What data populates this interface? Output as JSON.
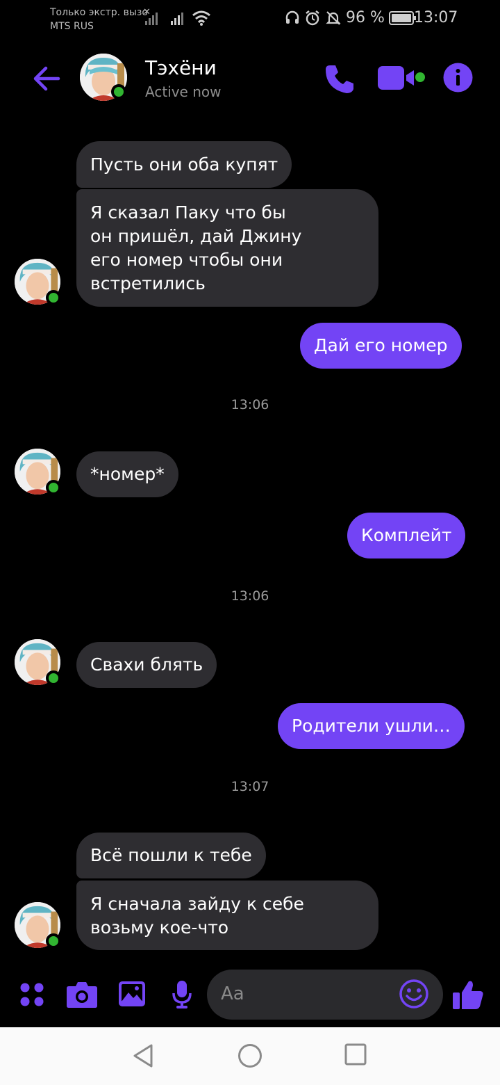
{
  "status_bar": {
    "carrier_line1": "Только экстр. вызо",
    "carrier_line2": "MTS RUS",
    "battery": "96 %",
    "time": "13:07"
  },
  "header": {
    "contact_name": "Тэхёни",
    "status": "Active now",
    "icons": [
      "back-arrow-icon",
      "phone-icon",
      "video-camera-icon",
      "info-icon"
    ]
  },
  "messages": [
    {
      "side": "in",
      "text": "Пусть они оба купят"
    },
    {
      "side": "in",
      "lines": [
        "Я сказал Паку что бы",
        "он пришёл, дай Джину",
        "его номер чтобы они",
        "встретились"
      ]
    },
    {
      "side": "out",
      "text": "Дай его номер"
    },
    {
      "timestamp": "13:06"
    },
    {
      "side": "in",
      "text": "*номер*"
    },
    {
      "side": "out",
      "text": "Комплейт"
    },
    {
      "timestamp": "13:06"
    },
    {
      "side": "in",
      "text": "Свахи блять"
    },
    {
      "side": "out",
      "text": "Родители ушли…"
    },
    {
      "timestamp": "13:07"
    },
    {
      "side": "in",
      "text": "Всё пошли к тебе"
    },
    {
      "side": "in",
      "lines": [
        "Я сначала зайду к себе",
        "возьму кое-что"
      ]
    }
  ],
  "composer": {
    "placeholder": "Aa",
    "icons": [
      "apps-grid-icon",
      "camera-icon",
      "gallery-icon",
      "microphone-icon",
      "emoji-icon",
      "thumbs-up-icon"
    ]
  },
  "colors": {
    "accent": "#7344f5",
    "incoming_bubble": "#2e2d31",
    "online": "#31b531"
  }
}
